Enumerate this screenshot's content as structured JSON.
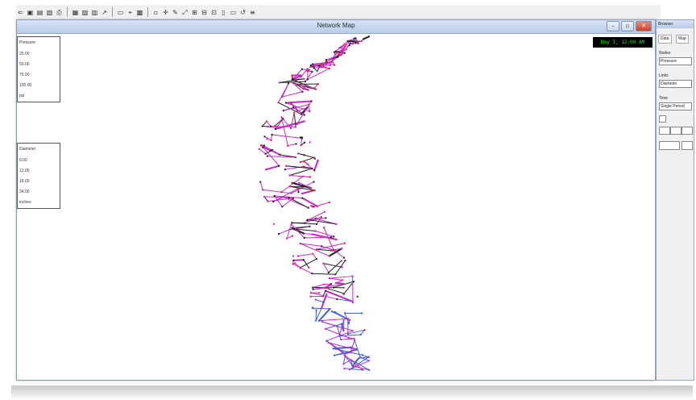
{
  "toolbar": {
    "buttons": [
      "⇐",
      "▣",
      "▤",
      "▧",
      "⎙",
      "▦",
      "▨",
      "▥",
      "↗",
      "▭",
      "⌖",
      "▩",
      "▫",
      "✛",
      "✎",
      "⤢",
      "⊞",
      "⊟",
      "⊡",
      "▯",
      "▭",
      "↺",
      "≡"
    ]
  },
  "map_window": {
    "title": "Network Map",
    "clock": "Day 1, 12:00 AM",
    "minimize_label": "–",
    "restore_label": "▫",
    "close_label": "✕"
  },
  "node_legend": {
    "title": "Pressure",
    "items": [
      "25.00",
      "50.00",
      "75.00",
      "100.00",
      "psi"
    ]
  },
  "link_legend": {
    "title": "Diameter",
    "items": [
      "6.00",
      "12.00",
      "18.00",
      "24.00",
      "inches"
    ]
  },
  "browser": {
    "title": "Browser",
    "tabs": [
      "Data",
      "Map"
    ],
    "nodes_label": "Nodes",
    "nodes_value": "Pressure",
    "links_label": "Links",
    "links_value": "Diameter",
    "time_label": "Time",
    "time_value": "Single Period"
  },
  "colors": {
    "low": "#3a5fd0",
    "mid": "#c02cc8",
    "high": "#e0203a",
    "dark": "#202020"
  }
}
